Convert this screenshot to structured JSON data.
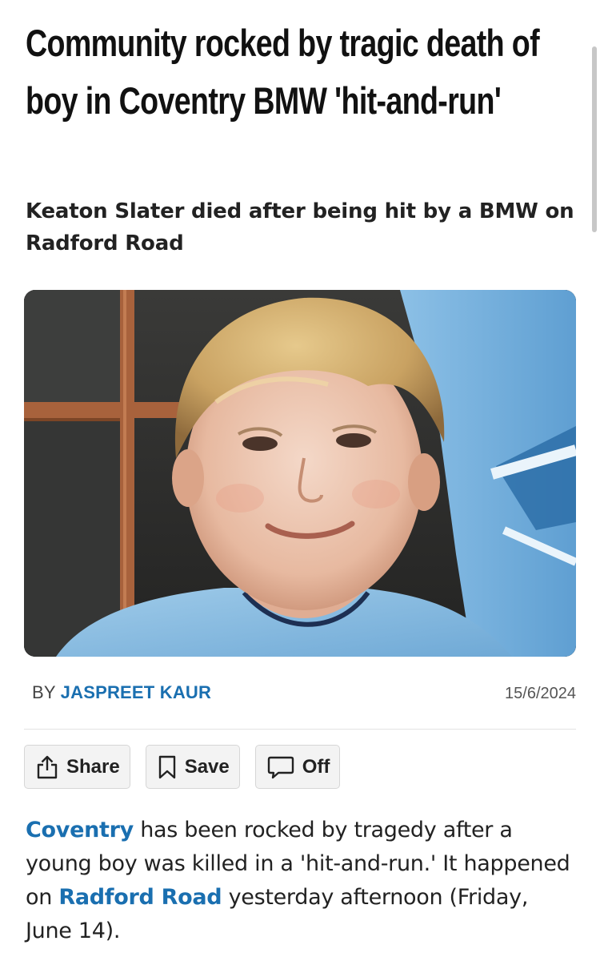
{
  "article": {
    "headline": "Community rocked by tragic death of boy in Coventry BMW 'hit-and-run'",
    "subheadline": "Keaton Slater died after being hit by a BMW on Radford Road",
    "byline_prefix": "BY ",
    "author": "JASPREET KAUR",
    "date": "15/6/2024"
  },
  "actions": {
    "share_label": "Share",
    "save_label": "Save",
    "comments_label": "Off"
  },
  "body": {
    "p1_link1": "Coventry",
    "p1_text1": " has been rocked by tragedy after a young boy was killed in a 'hit-and-run.' It happened on ",
    "p1_link2": "Radford Road",
    "p1_text2": " yesterday afternoon (Friday, June 14)."
  },
  "icons": {
    "share": "share-icon",
    "save": "bookmark-icon",
    "comments": "speech-bubble-icon"
  },
  "colors": {
    "link": "#1a6fb0",
    "text": "#222222"
  }
}
